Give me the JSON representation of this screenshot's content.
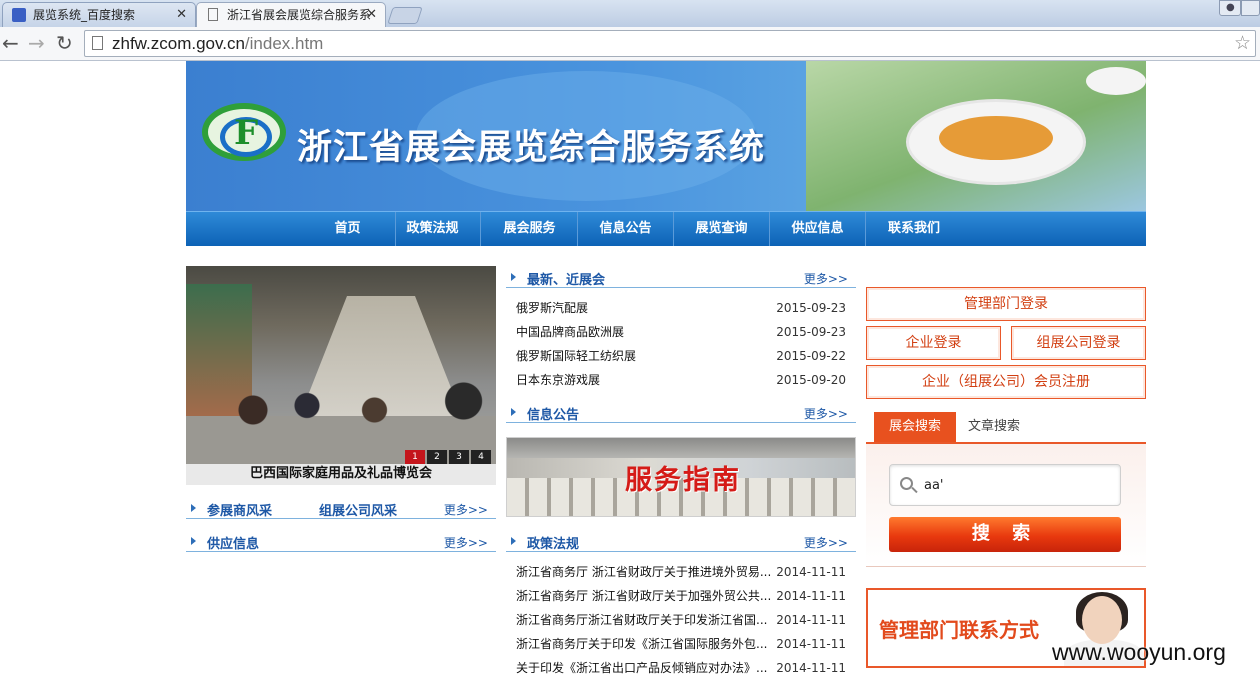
{
  "browser": {
    "tabs": [
      {
        "title": "展览系统_百度搜索",
        "icon": "paw-icon"
      },
      {
        "title": "浙江省展会展览综合服务系",
        "icon": "page-icon"
      }
    ],
    "url_host": "zhfw.zcom.gov.cn",
    "url_path": "/index.htm",
    "close_glyph": "✕",
    "back_glyph": "←",
    "forward_glyph": "→",
    "reload_glyph": "↻",
    "star_glyph": "☆"
  },
  "header": {
    "site_title": "浙江省展会展览综合服务系统"
  },
  "nav": {
    "items": [
      "首页",
      "政策法规",
      "展会服务",
      "信息公告",
      "展览查询",
      "供应信息",
      "联系我们"
    ]
  },
  "slideshow": {
    "caption": "巴西国际家庭用品及礼品博览会",
    "dots": [
      "1",
      "2",
      "3",
      "4"
    ],
    "active": 1
  },
  "left_sections": {
    "exhibitors": {
      "title": "参展商风采",
      "title2": "组展公司风采",
      "more": "更多>>"
    },
    "supply": {
      "title": "供应信息",
      "more": "更多>>"
    }
  },
  "latest_shows": {
    "title": "最新、近展会",
    "more": "更多>>",
    "items": [
      {
        "title": "俄罗斯汽配展",
        "date": "2015-09-23"
      },
      {
        "title": "中国品牌商品欧洲展",
        "date": "2015-09-23"
      },
      {
        "title": "俄罗斯国际轻工纺织展",
        "date": "2015-09-22"
      },
      {
        "title": "日本东京游戏展",
        "date": "2015-09-20"
      }
    ]
  },
  "announcements": {
    "title": "信息公告",
    "more": "更多>>",
    "banner_text": "服务指南"
  },
  "policies": {
    "title": "政策法规",
    "more": "更多>>",
    "items": [
      {
        "title": "浙江省商务厅 浙江省财政厅关于推进境外贸易...",
        "date": "2014-11-11"
      },
      {
        "title": "浙江省商务厅 浙江省财政厅关于加强外贸公共...",
        "date": "2014-11-11"
      },
      {
        "title": "浙江省商务厅浙江省财政厅关于印发浙江省国...",
        "date": "2014-11-11"
      },
      {
        "title": "浙江省商务厅关于印发《浙江省国际服务外包...",
        "date": "2014-11-11"
      },
      {
        "title": "关于印发《浙江省出口产品反倾销应对办法》...",
        "date": "2014-11-11"
      }
    ]
  },
  "login": {
    "admin": "管理部门登录",
    "enterprise": "企业登录",
    "organizer": "组展公司登录",
    "register": "企业（组展公司）会员注册"
  },
  "search": {
    "tabs": [
      "展会搜索",
      "文章搜索"
    ],
    "active_tab": 0,
    "value": "aa'",
    "button": "搜 索"
  },
  "contact": {
    "text": "管理部门联系方式"
  },
  "watermark": "www.wooyun.org",
  "colors": {
    "nav_blue": "#0d62b6",
    "accent_orange": "#e8511f",
    "link_blue": "#1e58a6"
  }
}
